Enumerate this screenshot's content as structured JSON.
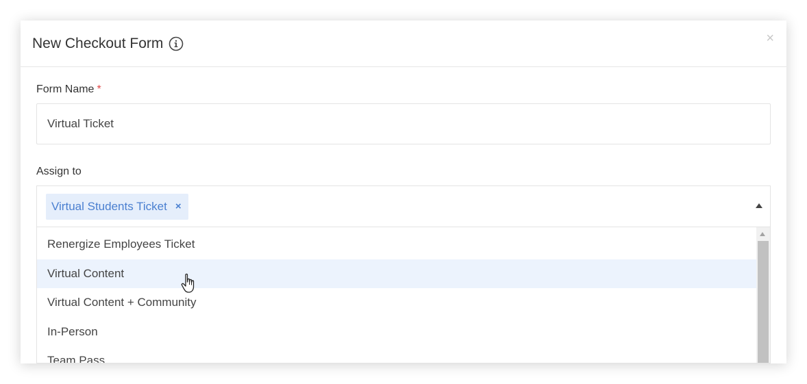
{
  "modal": {
    "title": "New Checkout Form",
    "close_label": "×",
    "icons": {
      "info": "info-icon",
      "close": "close-icon"
    }
  },
  "form_name": {
    "label": "Form Name",
    "required_marker": "*",
    "value": "Virtual Ticket"
  },
  "assign_to": {
    "label": "Assign to",
    "selected_tags": [
      {
        "label": "Virtual Students Ticket",
        "remove_label": "×"
      }
    ],
    "options": [
      "Renergize Employees Ticket",
      "Virtual Content",
      "Virtual Content + Community",
      "In-Person",
      "Team Pass"
    ],
    "highlighted_option": "Virtual Content"
  },
  "colors": {
    "tag_background": "#e5eefb",
    "tag_text": "#4a7fd0",
    "required": "#e04848",
    "highlight_row": "#ecf3fd"
  }
}
